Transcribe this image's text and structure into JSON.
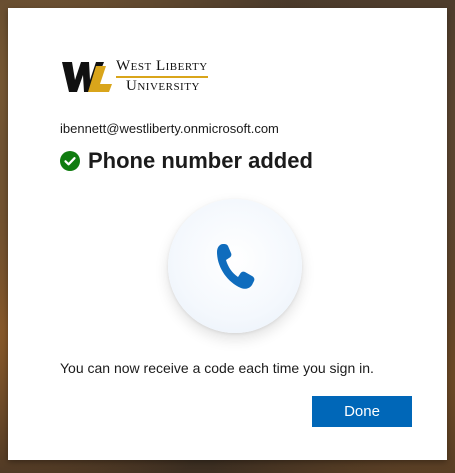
{
  "colors": {
    "accent": "#0067b8",
    "success": "#107c10",
    "logo_gold": "#d9a51b"
  },
  "logo": {
    "line1": "West Liberty",
    "line2": "University"
  },
  "identity": {
    "email": "ibennett@westliberty.onmicrosoft.com"
  },
  "title": {
    "text": "Phone number added",
    "icon": "check-circle-icon"
  },
  "illustration": {
    "icon": "phone-icon"
  },
  "message": {
    "text": "You can now receive a code each time you sign in."
  },
  "actions": {
    "done_label": "Done"
  }
}
